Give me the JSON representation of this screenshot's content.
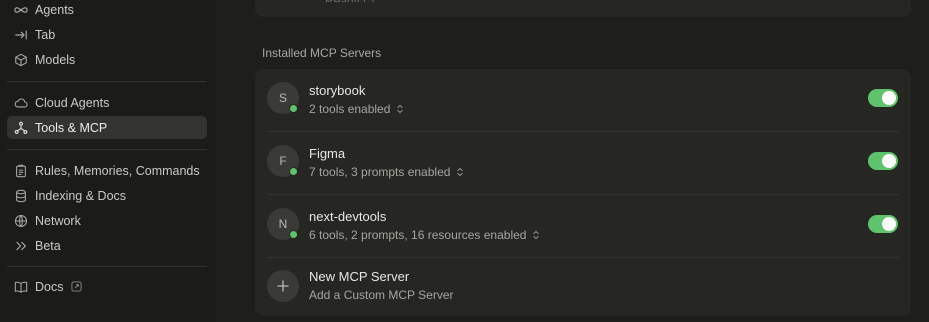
{
  "sidebar": {
    "items": [
      {
        "label": "Agents",
        "icon": "infinity-icon"
      },
      {
        "label": "Tab",
        "icon": "tab-arrow-icon"
      },
      {
        "label": "Models",
        "icon": "cube-icon"
      },
      {
        "label": "Cloud Agents",
        "icon": "cloud-icon"
      },
      {
        "label": "Tools & MCP",
        "icon": "tools-mcp-icon",
        "active": true
      },
      {
        "label": "Rules, Memories, Commands",
        "icon": "clipboard-icon"
      },
      {
        "label": "Indexing & Docs",
        "icon": "database-icon"
      },
      {
        "label": "Network",
        "icon": "globe-icon"
      },
      {
        "label": "Beta",
        "icon": "double-chevron-icon"
      },
      {
        "label": "Docs",
        "icon": "book-icon",
        "external": true
      }
    ]
  },
  "main": {
    "top_card_text": "Ready (                  )",
    "section_title": "Installed MCP Servers",
    "servers": [
      {
        "initial": "S",
        "name": "storybook",
        "summary": "2 tools enabled",
        "enabled": true
      },
      {
        "initial": "F",
        "name": "Figma",
        "summary": "7 tools, 3 prompts enabled",
        "enabled": true
      },
      {
        "initial": "N",
        "name": "next-devtools",
        "summary": "6 tools, 2 prompts, 16 resources enabled",
        "enabled": true
      }
    ],
    "new_server": {
      "title": "New MCP Server",
      "subtitle": "Add a Custom MCP Server"
    }
  },
  "colors": {
    "accent_green": "#5fc26d",
    "background": "#1e1e1c",
    "card": "#262623"
  }
}
